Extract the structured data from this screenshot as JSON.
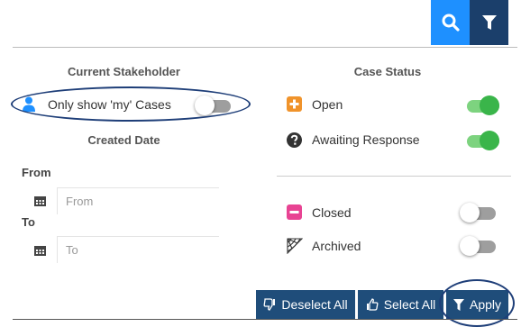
{
  "header": {
    "search_icon": "search-icon",
    "filter_icon": "filter-icon"
  },
  "stakeholder": {
    "title": "Current Stakeholder",
    "only_mine_label": "Only show 'my' Cases",
    "only_mine_enabled": false
  },
  "created_date": {
    "title": "Created Date",
    "from_label": "From",
    "from_placeholder": "From",
    "to_label": "To",
    "to_placeholder": "To"
  },
  "case_status": {
    "title": "Case Status",
    "items": [
      {
        "label": "Open",
        "icon": "plus-square-icon",
        "color": "#f0932b",
        "enabled": true
      },
      {
        "label": "Awaiting Response",
        "icon": "question-circle-icon",
        "color": "#333333",
        "enabled": true
      },
      {
        "label": "Closed",
        "icon": "minus-square-icon",
        "color": "#e84393",
        "enabled": false
      },
      {
        "label": "Archived",
        "icon": "spider-web-icon",
        "color": "#333333",
        "enabled": false
      }
    ]
  },
  "footer": {
    "deselect_all_label": "Deselect All",
    "select_all_label": "Select All",
    "apply_label": "Apply"
  },
  "colors": {
    "search_button": "#1e90ff",
    "filter_button": "#1b3f6b",
    "action_button": "#1f4d7a",
    "toggle_on": "#3ab54a",
    "highlight_ellipse": "#1e3e78"
  }
}
